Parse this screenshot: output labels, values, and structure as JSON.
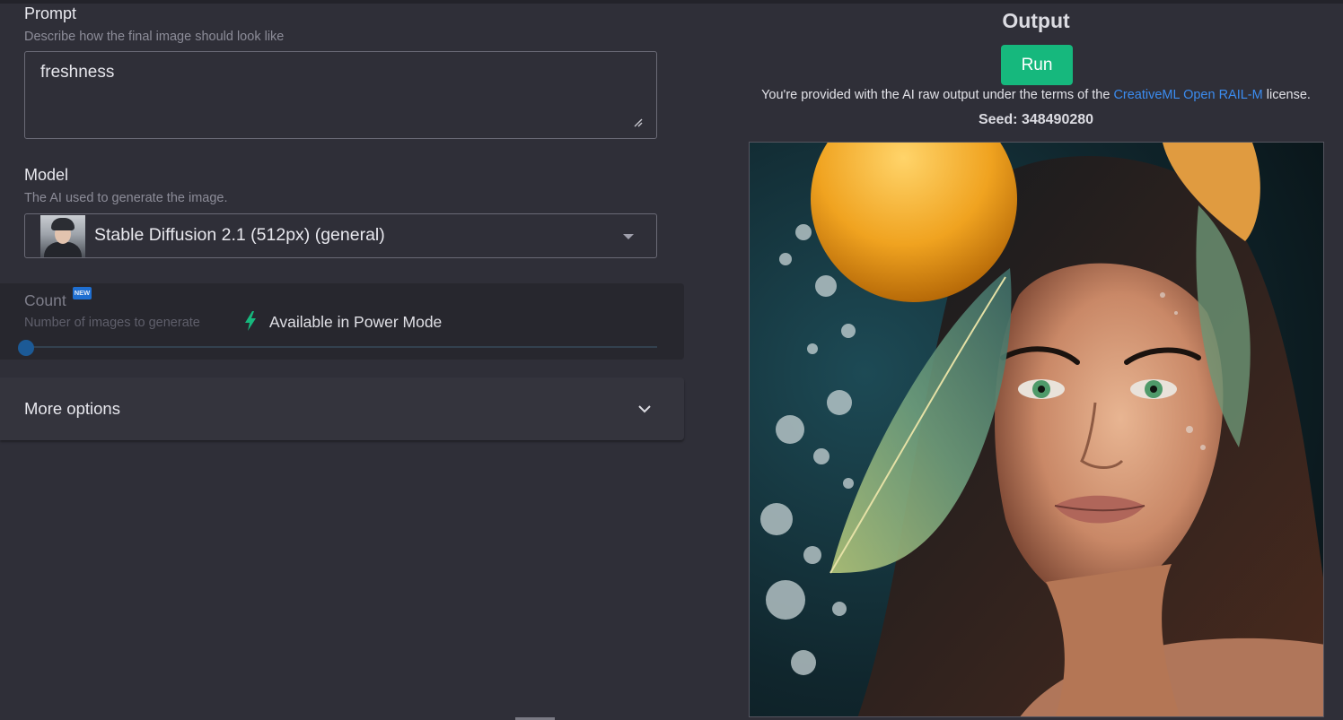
{
  "prompt": {
    "label": "Prompt",
    "hint": "Describe how the final image should look like",
    "value": "freshness"
  },
  "model": {
    "label": "Model",
    "hint": "The AI used to generate the image.",
    "selected": "Stable Diffusion 2.1 (512px) (general)"
  },
  "count": {
    "label": "Count",
    "badge": "NEW",
    "hint": "Number of images to generate",
    "power_text": "Available in Power Mode",
    "value": 1
  },
  "more_options": {
    "label": "More options"
  },
  "output": {
    "title": "Output",
    "run_label": "Run",
    "license_prefix": "You're provided with the AI raw output under the terms of the",
    "license_link": "CreativeML Open RAIL-M",
    "license_suffix": "license.",
    "seed": "Seed: 348490280"
  },
  "colors": {
    "background": "#2f2f38",
    "run_button": "#16b87d",
    "link": "#3b8cf0",
    "power_icon": "#16b87d",
    "slider": "#1c5a96"
  }
}
